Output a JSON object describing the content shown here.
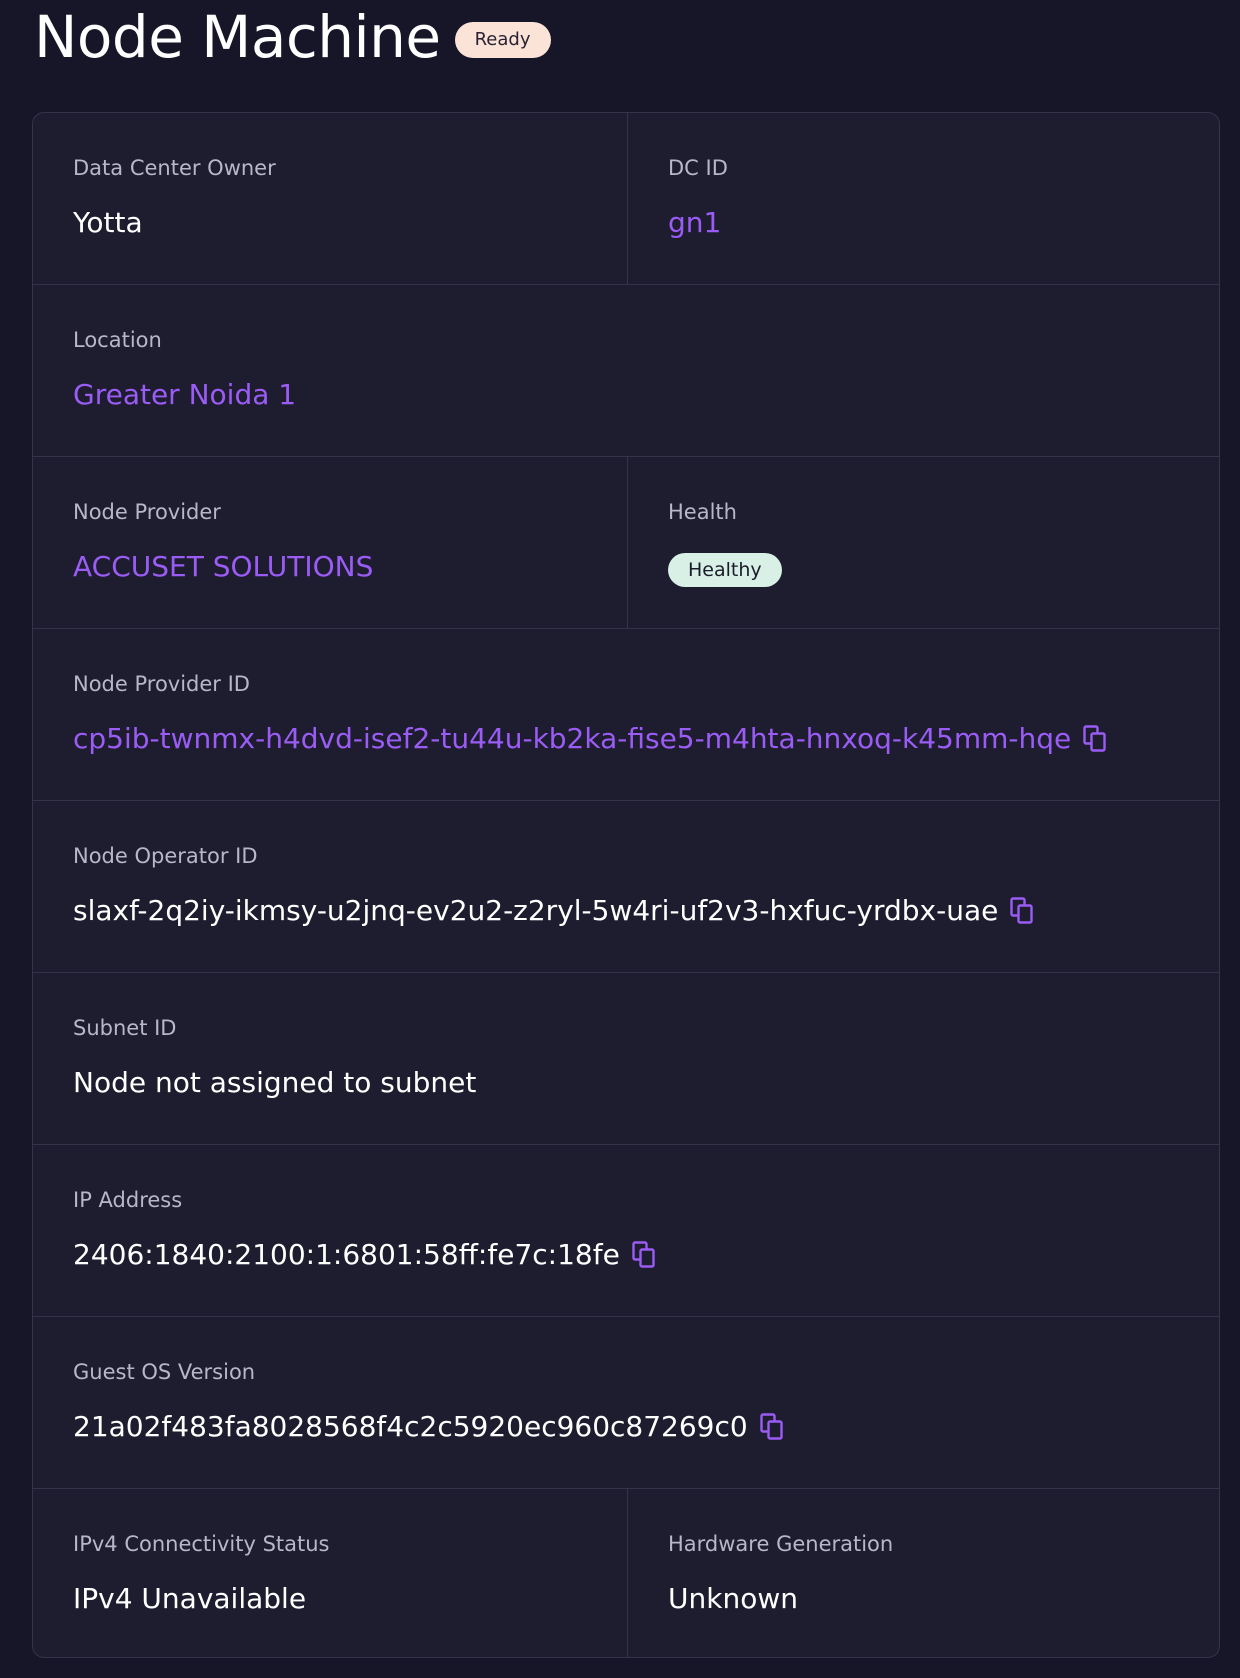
{
  "header": {
    "title": "Node Machine",
    "status": "Ready"
  },
  "fields": {
    "dc_owner": {
      "label": "Data Center Owner",
      "value": "Yotta"
    },
    "dc_id": {
      "label": "DC ID",
      "value": "gn1"
    },
    "location": {
      "label": "Location",
      "value": "Greater Noida 1"
    },
    "node_provider": {
      "label": "Node Provider",
      "value": "ACCUSET SOLUTIONS"
    },
    "health": {
      "label": "Health",
      "value": "Healthy"
    },
    "node_provider_id": {
      "label": "Node Provider ID",
      "value": "cp5ib-twnmx-h4dvd-isef2-tu44u-kb2ka-fise5-m4hta-hnxoq-k45mm-hqe"
    },
    "node_operator_id": {
      "label": "Node Operator ID",
      "value": "slaxf-2q2iy-ikmsy-u2jnq-ev2u2-z2ryl-5w4ri-uf2v3-hxfuc-yrdbx-uae"
    },
    "subnet_id": {
      "label": "Subnet ID",
      "value": "Node not assigned to subnet"
    },
    "ip_address": {
      "label": "IP Address",
      "value": "2406:1840:2100:1:6801:58ff:fe7c:18fe"
    },
    "guest_os_version": {
      "label": "Guest OS Version",
      "value": "21a02f483fa8028568f4c2c5920ec960c87269c0"
    },
    "ipv4_status": {
      "label": "IPv4 Connectivity Status",
      "value": "IPv4 Unavailable"
    },
    "hardware_generation": {
      "label": "Hardware Generation",
      "value": "Unknown"
    }
  },
  "icons": {
    "copy": "copy-icon"
  },
  "colors": {
    "background": "#171629",
    "card": "#1e1d2f",
    "link": "#9a5cf5",
    "ready_badge": "#fbe3d8",
    "healthy_badge": "#d9f0e6"
  }
}
